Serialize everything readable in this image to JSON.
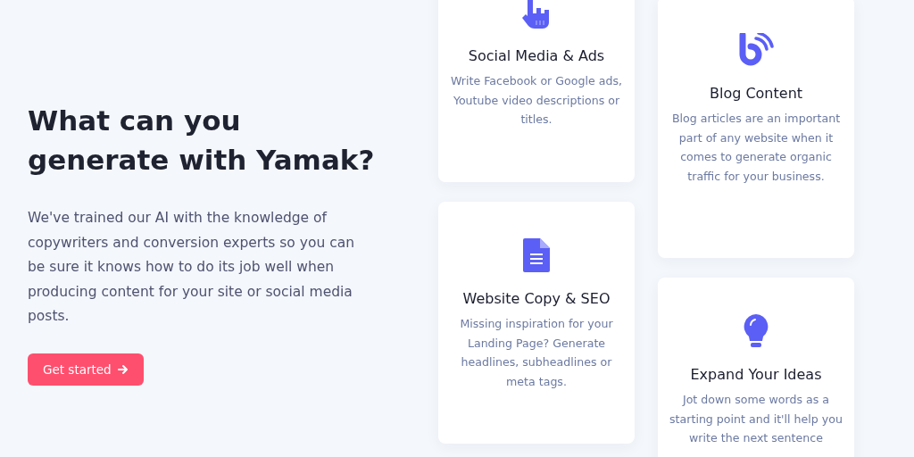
{
  "hero": {
    "heading": "What can you generate with Yamak?",
    "body": "We've trained our AI with the knowledge of copywriters and conversion experts so you can be sure it knows how to do its job well when producing content for your site or social media posts.",
    "button": "Get started"
  },
  "columns": [
    {
      "cards": [
        {
          "kind": "hand",
          "title": "Social Media & Ads",
          "description": "Write Facebook or Google ads, Youtube video descriptions or titles."
        },
        {
          "kind": "document",
          "title": "Website Copy & SEO",
          "description": "Missing inspiration for your Landing Page? Generate headlines, subheadlines or meta tags."
        }
      ]
    },
    {
      "cards": [
        {
          "kind": "blog",
          "title": "Blog Content",
          "description": "Blog articles are an important part of any website when it comes to generate organic traffic for your business."
        },
        {
          "kind": "bulb",
          "title": "Expand Your Ideas",
          "description": "Jot down some words as a starting point and it'll help you write the next sentence"
        }
      ]
    }
  ]
}
